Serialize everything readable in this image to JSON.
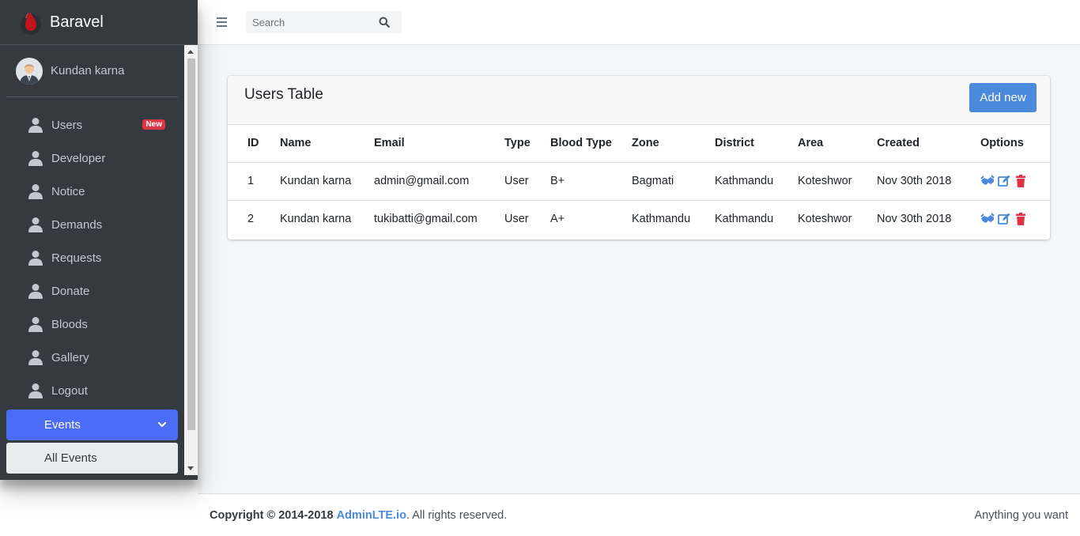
{
  "brand": {
    "name": "Baravel"
  },
  "user": {
    "name": "Kundan karna"
  },
  "sidebar": {
    "items": [
      {
        "label": "Users",
        "badge": "New"
      },
      {
        "label": "Developer"
      },
      {
        "label": "Notice"
      },
      {
        "label": "Demands"
      },
      {
        "label": "Requests"
      },
      {
        "label": "Donate"
      },
      {
        "label": "Bloods"
      },
      {
        "label": "Gallery"
      },
      {
        "label": "Logout"
      }
    ],
    "events": {
      "label": "Events",
      "sub_items": [
        {
          "label": "All Events"
        }
      ]
    }
  },
  "header": {
    "search_placeholder": "Search"
  },
  "card": {
    "title": "Users Table",
    "add_label": "Add new",
    "columns": [
      "ID",
      "Name",
      "Email",
      "Type",
      "Blood Type",
      "Zone",
      "District",
      "Area",
      "Created",
      "Options"
    ],
    "rows": [
      [
        "1",
        "Kundan karna",
        "admin@gmail.com",
        "User",
        "B+",
        "Bagmati",
        "Kathmandu",
        "Koteshwor",
        "Nov 30th 2018"
      ],
      [
        "2",
        "Kundan karna",
        "tukibatti@gmail.com",
        "User",
        "A+",
        "Kathmandu",
        "Kathmandu",
        "Koteshwor",
        "Nov 30th 2018"
      ]
    ]
  },
  "footer": {
    "copyright": "Copyright © 2014-2018",
    "link": "AdminLTE.io",
    "rights": ". All rights reserved.",
    "right": "Anything you want"
  },
  "colors": {
    "sidebar_bg": "#343a40",
    "accent": "#4a6cf7",
    "button": "#4a89dc",
    "danger": "#dc3545"
  }
}
